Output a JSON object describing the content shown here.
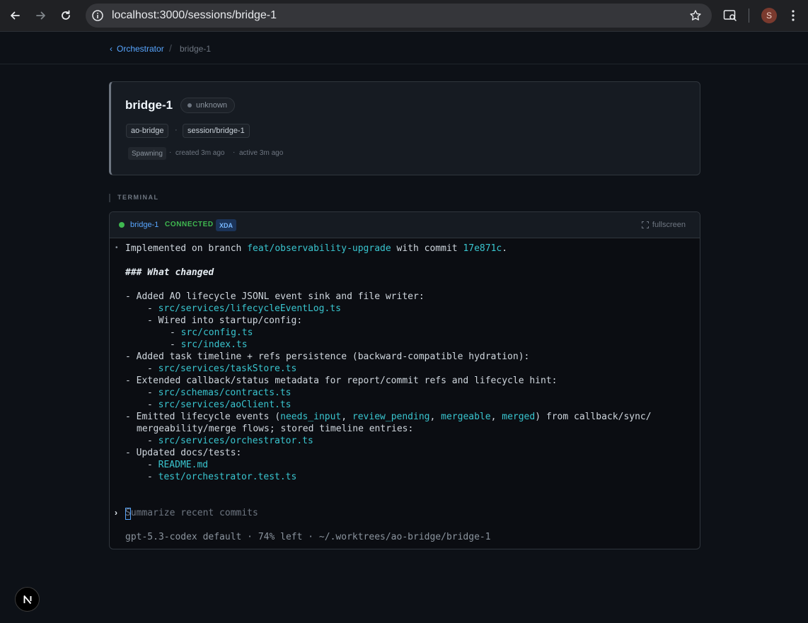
{
  "browser": {
    "url": "localhost:3000/sessions/bridge-1",
    "avatar_initial": "S"
  },
  "breadcrumb": {
    "back_label": "Orchestrator",
    "separator": "/",
    "current": "bridge-1"
  },
  "session": {
    "title": "bridge-1",
    "status": "unknown",
    "project_tag": "ao-bridge",
    "branch_tag": "session/bridge-1",
    "separator": "·",
    "activity": "Spawning",
    "created": "created 3m ago",
    "active": "active 3m ago"
  },
  "section": {
    "terminal_label": "TERMINAL"
  },
  "terminal": {
    "name": "bridge-1",
    "status": "CONNECTED",
    "badge": "XDA",
    "fullscreen_label": "fullscreen",
    "bullet": "•",
    "line1": {
      "pre": "Implemented on branch ",
      "branch": "feat/observability-upgrade",
      "mid": " with commit ",
      "commit": "17e871c",
      "post": "."
    },
    "heading": "### What changed",
    "l_added_sink": "- Added AO lifecycle JSONL event sink and file writer:",
    "f_lifecycle": "src/services/lifecycleEventLog.ts",
    "l_wired": "- Wired into startup/config:",
    "f_config": "src/config.ts",
    "f_index": "src/index.ts",
    "l_task_timeline": "- Added task timeline + refs persistence (backward-compatible hydration):",
    "f_taskstore": "src/services/taskStore.ts",
    "l_extended": "- Extended callback/status metadata for report/commit refs and lifecycle hint:",
    "f_contracts": "src/schemas/contracts.ts",
    "f_aoclient": "src/services/aoClient.ts",
    "l_emitted": {
      "pre": "- Emitted lifecycle events (",
      "e1": "needs_input",
      "c1": ", ",
      "e2": "review_pending",
      "c2": ", ",
      "e3": "mergeable",
      "c3": ", ",
      "e4": "merged",
      "post": ") from callback/sync/"
    },
    "l_emitted_cont": "mergeability/merge flows; stored timeline entries:",
    "f_orchestrator": "src/services/orchestrator.ts",
    "l_updated_docs": "- Updated docs/tests:",
    "f_readme": "README.md",
    "f_test": "test/orchestrator.test.ts",
    "prompt_chevron": "›",
    "prompt_placeholder": "Summarize recent commits",
    "footer": "gpt-5.3-codex default · 74% left · ~/.worktrees/ao-bridge/bridge-1"
  },
  "colors": {
    "accent_link": "#58a6ff",
    "terminal_accent": "#39c5cf",
    "connected": "#3fb950",
    "background": "#0d1117"
  }
}
